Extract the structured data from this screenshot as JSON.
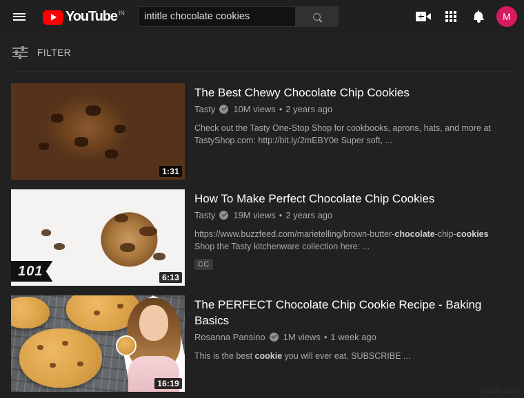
{
  "header": {
    "menu_icon": "hamburger-menu-icon",
    "logo_text": "YouTube",
    "logo_country": "IN",
    "search": {
      "value": "intitle chocolate cookies",
      "placeholder": "Search",
      "button_icon": "search-icon"
    },
    "icons": [
      {
        "name": "create-video-icon",
        "label": "Create"
      },
      {
        "name": "apps-grid-icon",
        "label": "YouTube apps"
      },
      {
        "name": "notifications-bell-icon",
        "label": "Notifications"
      }
    ],
    "avatar_letter": "M",
    "avatar_color": "#d81b60"
  },
  "filter": {
    "label": "FILTER",
    "icon": "tune-filter-icon"
  },
  "results": [
    {
      "title": "The Best Chewy Chocolate Chip Cookies",
      "channel": "Tasty",
      "verified": true,
      "views": "10M views",
      "age": "2 years ago",
      "separator": "•",
      "description_html": "Check out the Tasty One-Stop Shop for cookbooks, aprons, hats, and more at TastyShop.com: http://bit.ly/2mEBY0e Super soft, ...",
      "duration": "1:31",
      "cc": false,
      "ribbon": null
    },
    {
      "title": "How To Make Perfect Chocolate Chip Cookies",
      "channel": "Tasty",
      "verified": true,
      "views": "19M views",
      "age": "2 years ago",
      "separator": "•",
      "description_html": "https://www.buzzfeed.com/marietelling/brown-butter-<b>chocolate</b>-chip-<b>cookies</b> Shop the Tasty kitchenware collection here: ...",
      "duration": "6:13",
      "cc": true,
      "cc_label": "CC",
      "ribbon": "101"
    },
    {
      "title": "The PERFECT Chocolate Chip Cookie Recipe - Baking Basics",
      "channel": "Rosanna Pansino",
      "verified": true,
      "views": "1M views",
      "age": "1 week ago",
      "separator": "•",
      "description_html": "This is the best <b>cookie</b> you will ever eat. SUBSCRIBE ...",
      "duration": "16:19",
      "cc": false,
      "ribbon": null
    }
  ],
  "watermark": "wsxdn.com"
}
